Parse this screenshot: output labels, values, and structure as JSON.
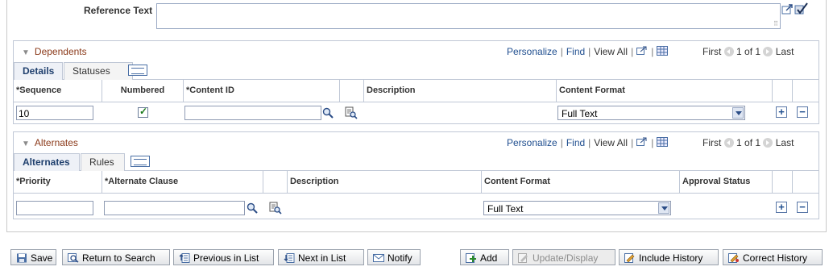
{
  "reference": {
    "label": "Reference Text",
    "value": "",
    "icons": [
      "expand-icon",
      "spellcheck-icon"
    ]
  },
  "dependents": {
    "title": "Dependents",
    "nav": {
      "personalize": "Personalize",
      "find": "Find",
      "view_all": "View All"
    },
    "pager": {
      "first": "First",
      "range": "1 of 1",
      "last": "Last"
    },
    "tabs": [
      "Details",
      "Statuses"
    ],
    "columns": [
      "*Sequence",
      "Numbered",
      "*Content ID",
      "Description",
      "Content Format"
    ],
    "row": {
      "sequence": "10",
      "numbered": true,
      "content_id": "",
      "description": "",
      "content_format": "Full Text"
    }
  },
  "alternates": {
    "title": "Alternates",
    "nav": {
      "personalize": "Personalize",
      "find": "Find",
      "view_all": "View All"
    },
    "pager": {
      "first": "First",
      "range": "1 of 1",
      "last": "Last"
    },
    "tabs": [
      "Alternates",
      "Rules"
    ],
    "columns": [
      "*Priority",
      "*Alternate Clause",
      "Description",
      "Content Format",
      "Approval Status"
    ],
    "row": {
      "priority": "",
      "alternate_clause": "",
      "description": "",
      "content_format": "Full Text",
      "approval_status": ""
    }
  },
  "toolbar": {
    "save": "Save",
    "return_to_search": "Return to Search",
    "previous_in_list": "Previous in List",
    "next_in_list": "Next in List",
    "notify": "Notify",
    "add": "Add",
    "update_display": "Update/Display",
    "include_history": "Include History",
    "correct_history": "Correct History"
  },
  "colors": {
    "link": "#1f4e8f",
    "section_title": "#8b3a1a",
    "border": "#c0c8d6"
  }
}
